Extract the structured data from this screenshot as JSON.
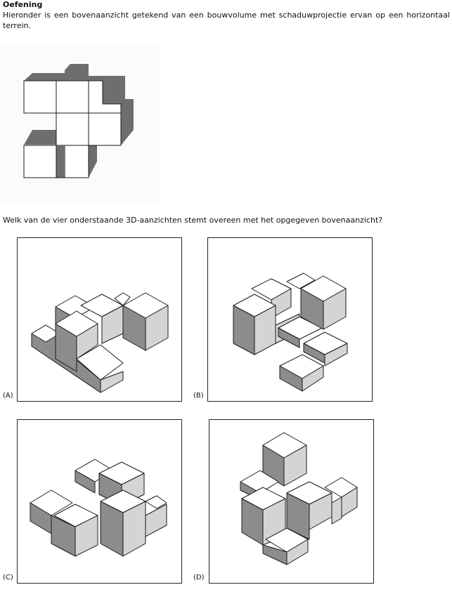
{
  "exercise": {
    "title": "Oefening",
    "intro": "Hieronder is een bovenaanzicht getekend van een bouwvolume met schaduwprojectie ervan op een horizontaal terrein.",
    "question": "Welk van de vier onderstaande 3D-aanzichten stemt overeen met het opgegeven bovenaanzicht?"
  },
  "options": [
    {
      "label": "(A)"
    },
    {
      "label": "(B)"
    },
    {
      "label": "(C)"
    },
    {
      "label": "(D)"
    }
  ],
  "colors": {
    "top_face": "#ffffff",
    "left_face": "#8c8c8c",
    "right_face": "#d4d4d4",
    "shadow": "#6e6e6e",
    "edge": "#1a1a1a"
  }
}
